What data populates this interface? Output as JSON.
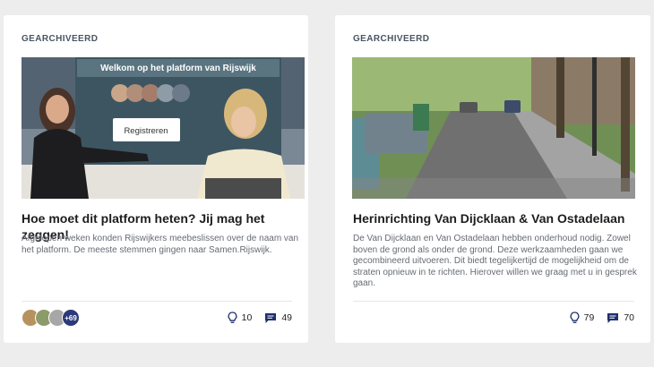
{
  "cards": [
    {
      "status": "GEARCHIVEERD",
      "image_overlay": "Welkom op het platform van Rijswijk",
      "image_button": "Registreren",
      "title": "Hoe moet dit platform heten? Jij mag het zeggen!",
      "description": "Afgelopen weken konden Rijswijkers meebeslissen over de naam van het platform. De meeste stemmen gingen naar Samen.Rijswijk.",
      "avatar_more": "+69",
      "ideas_count": "10",
      "comments_count": "49"
    },
    {
      "status": "GEARCHIVEERD",
      "title": "Herinrichting Van Dijcklaan & Van Ostadelaan",
      "description": "De Van Dijcklaan en Van Ostadelaan hebben onderhoud nodig. Zowel boven de grond als onder de grond. Deze werkzaamheden gaan we gecombineerd uitvoeren. Dit biedt tegelijkertijd de mogelijkheid om de straten opnieuw in te richten. Hierover willen we graag met u in gesprek gaan.",
      "ideas_count": "79",
      "comments_count": "70"
    }
  ],
  "icons": {
    "ideas": "lightbulb-icon",
    "comments": "chat-bubble-icon"
  },
  "colors": {
    "accent": "#2c3a7a",
    "icon": "#1f2f6e"
  }
}
